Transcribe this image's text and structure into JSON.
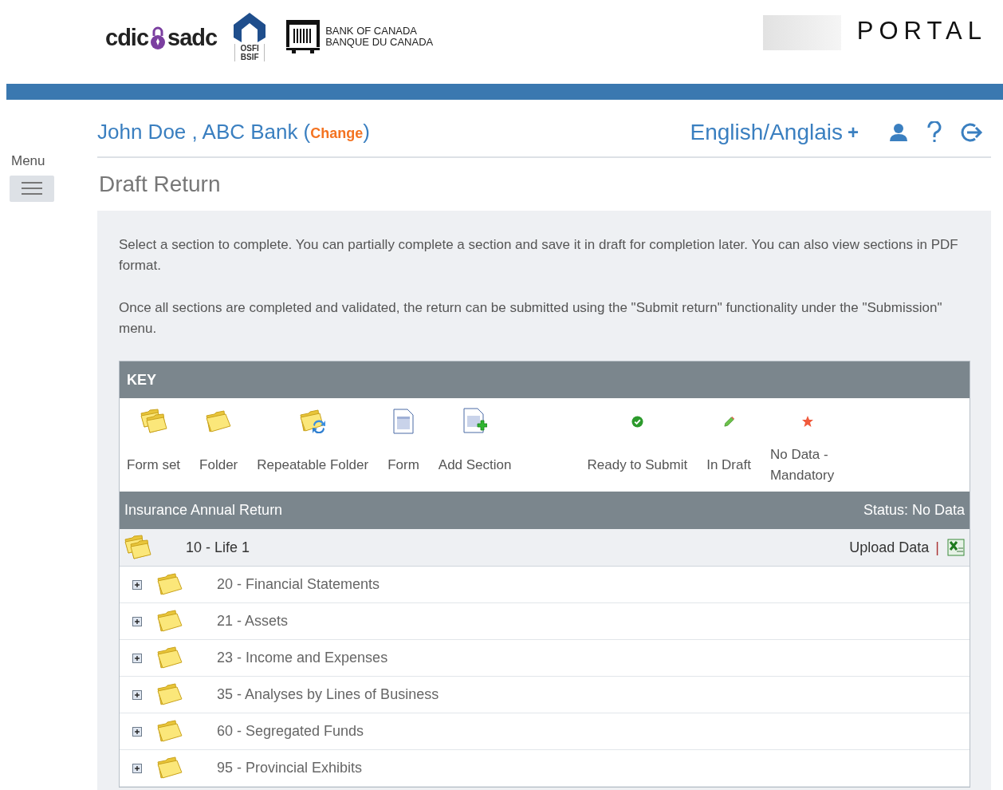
{
  "header": {
    "cdic_logo": {
      "left": "cdic",
      "right": "sadc"
    },
    "osfi_logo": {
      "line1": "OSFI",
      "line2": "BSIF"
    },
    "boc_logo": {
      "line1": "BANK OF CANADA",
      "line2": "BANQUE DU CANADA"
    },
    "portal": "PORTAL"
  },
  "user_bar": {
    "user": "John Doe , ABC Bank",
    "change": {
      "open": "(",
      "label": "Change",
      "close": ")"
    },
    "language": "English/Anglais",
    "language_plus": "+"
  },
  "menu": {
    "label": "Menu"
  },
  "page_title": "Draft Return",
  "paragraphs": [
    "Select a section to complete. You can partially complete a section and save it in draft for completion later. You can also view sections in PDF format.",
    "Once all sections are completed and validated, the return can be submitted using the \"Submit return\" functionality under the \"Submission\" menu."
  ],
  "key": {
    "title": "KEY",
    "items": [
      {
        "kind": "formset",
        "label": "Form set"
      },
      {
        "kind": "folder",
        "label": "Folder"
      },
      {
        "kind": "repeatable",
        "label": "Repeatable Folder"
      },
      {
        "kind": "form",
        "label": "Form"
      },
      {
        "kind": "add",
        "label": "Add Section"
      },
      {
        "kind": "ready",
        "label": "Ready to Submit"
      },
      {
        "kind": "draft",
        "label": "In Draft"
      },
      {
        "kind": "mandatory",
        "label": "No Data - Mandatory"
      }
    ]
  },
  "return": {
    "title": "Insurance Annual Return",
    "status": "Status: No Data",
    "root": {
      "label": "10 - Life 1",
      "upload": "Upload Data",
      "separator": "|",
      "children": [
        {
          "label": "20 - Financial Statements",
          "expanded": false
        },
        {
          "label": "21 - Assets",
          "expanded": false
        },
        {
          "label": "23 - Income and Expenses",
          "expanded": false
        },
        {
          "label": "35 - Analyses by Lines of Business",
          "expanded": false
        },
        {
          "label": "60 - Segregated Funds",
          "expanded": false
        },
        {
          "label": "95 - Provincial Exhibits",
          "expanded": false
        }
      ]
    }
  }
}
